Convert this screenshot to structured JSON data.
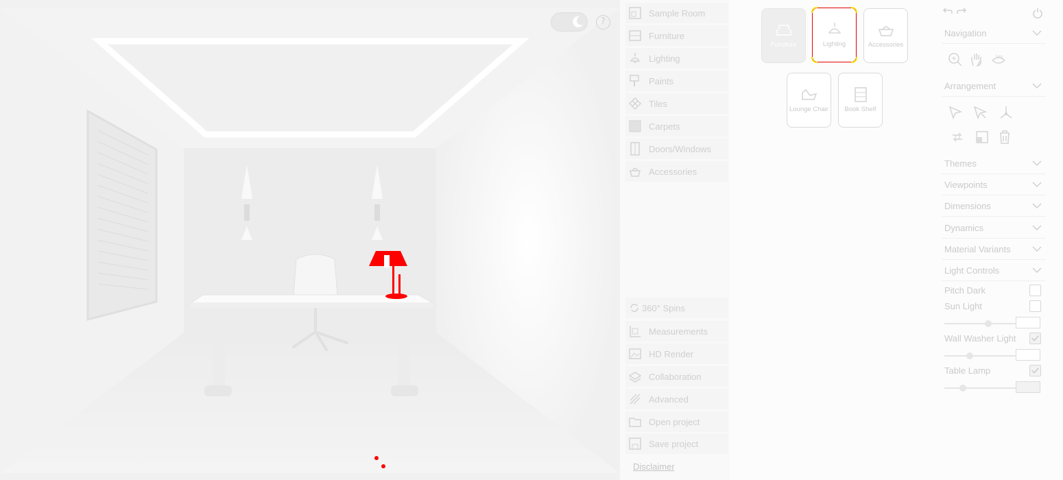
{
  "viewport": {
    "help_label": "?"
  },
  "menu": {
    "top_items": [
      {
        "label": "Sample Room",
        "icon": "sample-room-icon"
      },
      {
        "label": "Furniture",
        "icon": "furniture-icon"
      },
      {
        "label": "Lighting",
        "icon": "lighting-icon"
      },
      {
        "label": "Paints",
        "icon": "paints-icon"
      },
      {
        "label": "Tiles",
        "icon": "tiles-icon"
      },
      {
        "label": "Carpets",
        "icon": "carpets-icon"
      },
      {
        "label": "Doors/Windows",
        "icon": "doors-windows-icon"
      },
      {
        "label": "Accessories",
        "icon": "accessories-icon"
      }
    ],
    "bottom_items": [
      {
        "label": "360° Spins",
        "icon": "spin-icon"
      },
      {
        "label": "Measurements",
        "icon": "measurements-icon"
      },
      {
        "label": "HD Render",
        "icon": "hd-render-icon"
      },
      {
        "label": "Collaboration",
        "icon": "collaboration-icon"
      },
      {
        "label": "Advanced",
        "icon": "advanced-icon"
      },
      {
        "label": "Open project",
        "icon": "open-project-icon"
      },
      {
        "label": "Save project",
        "icon": "save-project-icon"
      }
    ],
    "disclaimer": "Disclaimer"
  },
  "catalog": {
    "tiles": [
      {
        "label": "Furniture",
        "icon": "sofa-icon"
      },
      {
        "label": "Lighting",
        "icon": "pendant-lamp-icon",
        "selected": true
      },
      {
        "label": "Accessories",
        "icon": "basket-icon"
      },
      {
        "label": "Lounge Chair",
        "icon": "lounge-chair-icon"
      },
      {
        "label": "Book Shelf",
        "icon": "book-shelf-icon"
      }
    ]
  },
  "controls": {
    "sections": [
      "Navigation",
      "Arrangement",
      "Themes",
      "Viewpoints",
      "Dimensions",
      "Dynamics",
      "Material Variants",
      "Light Controls"
    ],
    "navigation_tools": [
      "zoom-icon",
      "pan-hand-icon",
      "rotate-360-icon"
    ],
    "arrangement_tools": [
      "select-icon",
      "multi-select-icon",
      "move-axis-icon",
      "swap-icon",
      "scale-icon",
      "delete-icon"
    ],
    "lights": [
      {
        "label": "Pitch Dark",
        "checked": false
      },
      {
        "label": "Sun Light",
        "checked": false,
        "intensity": 0.55
      },
      {
        "label": "Wall Washer Light",
        "checked": true,
        "intensity": 0.3
      },
      {
        "label": "Table Lamp",
        "checked": true,
        "intensity": 0.2
      }
    ]
  }
}
